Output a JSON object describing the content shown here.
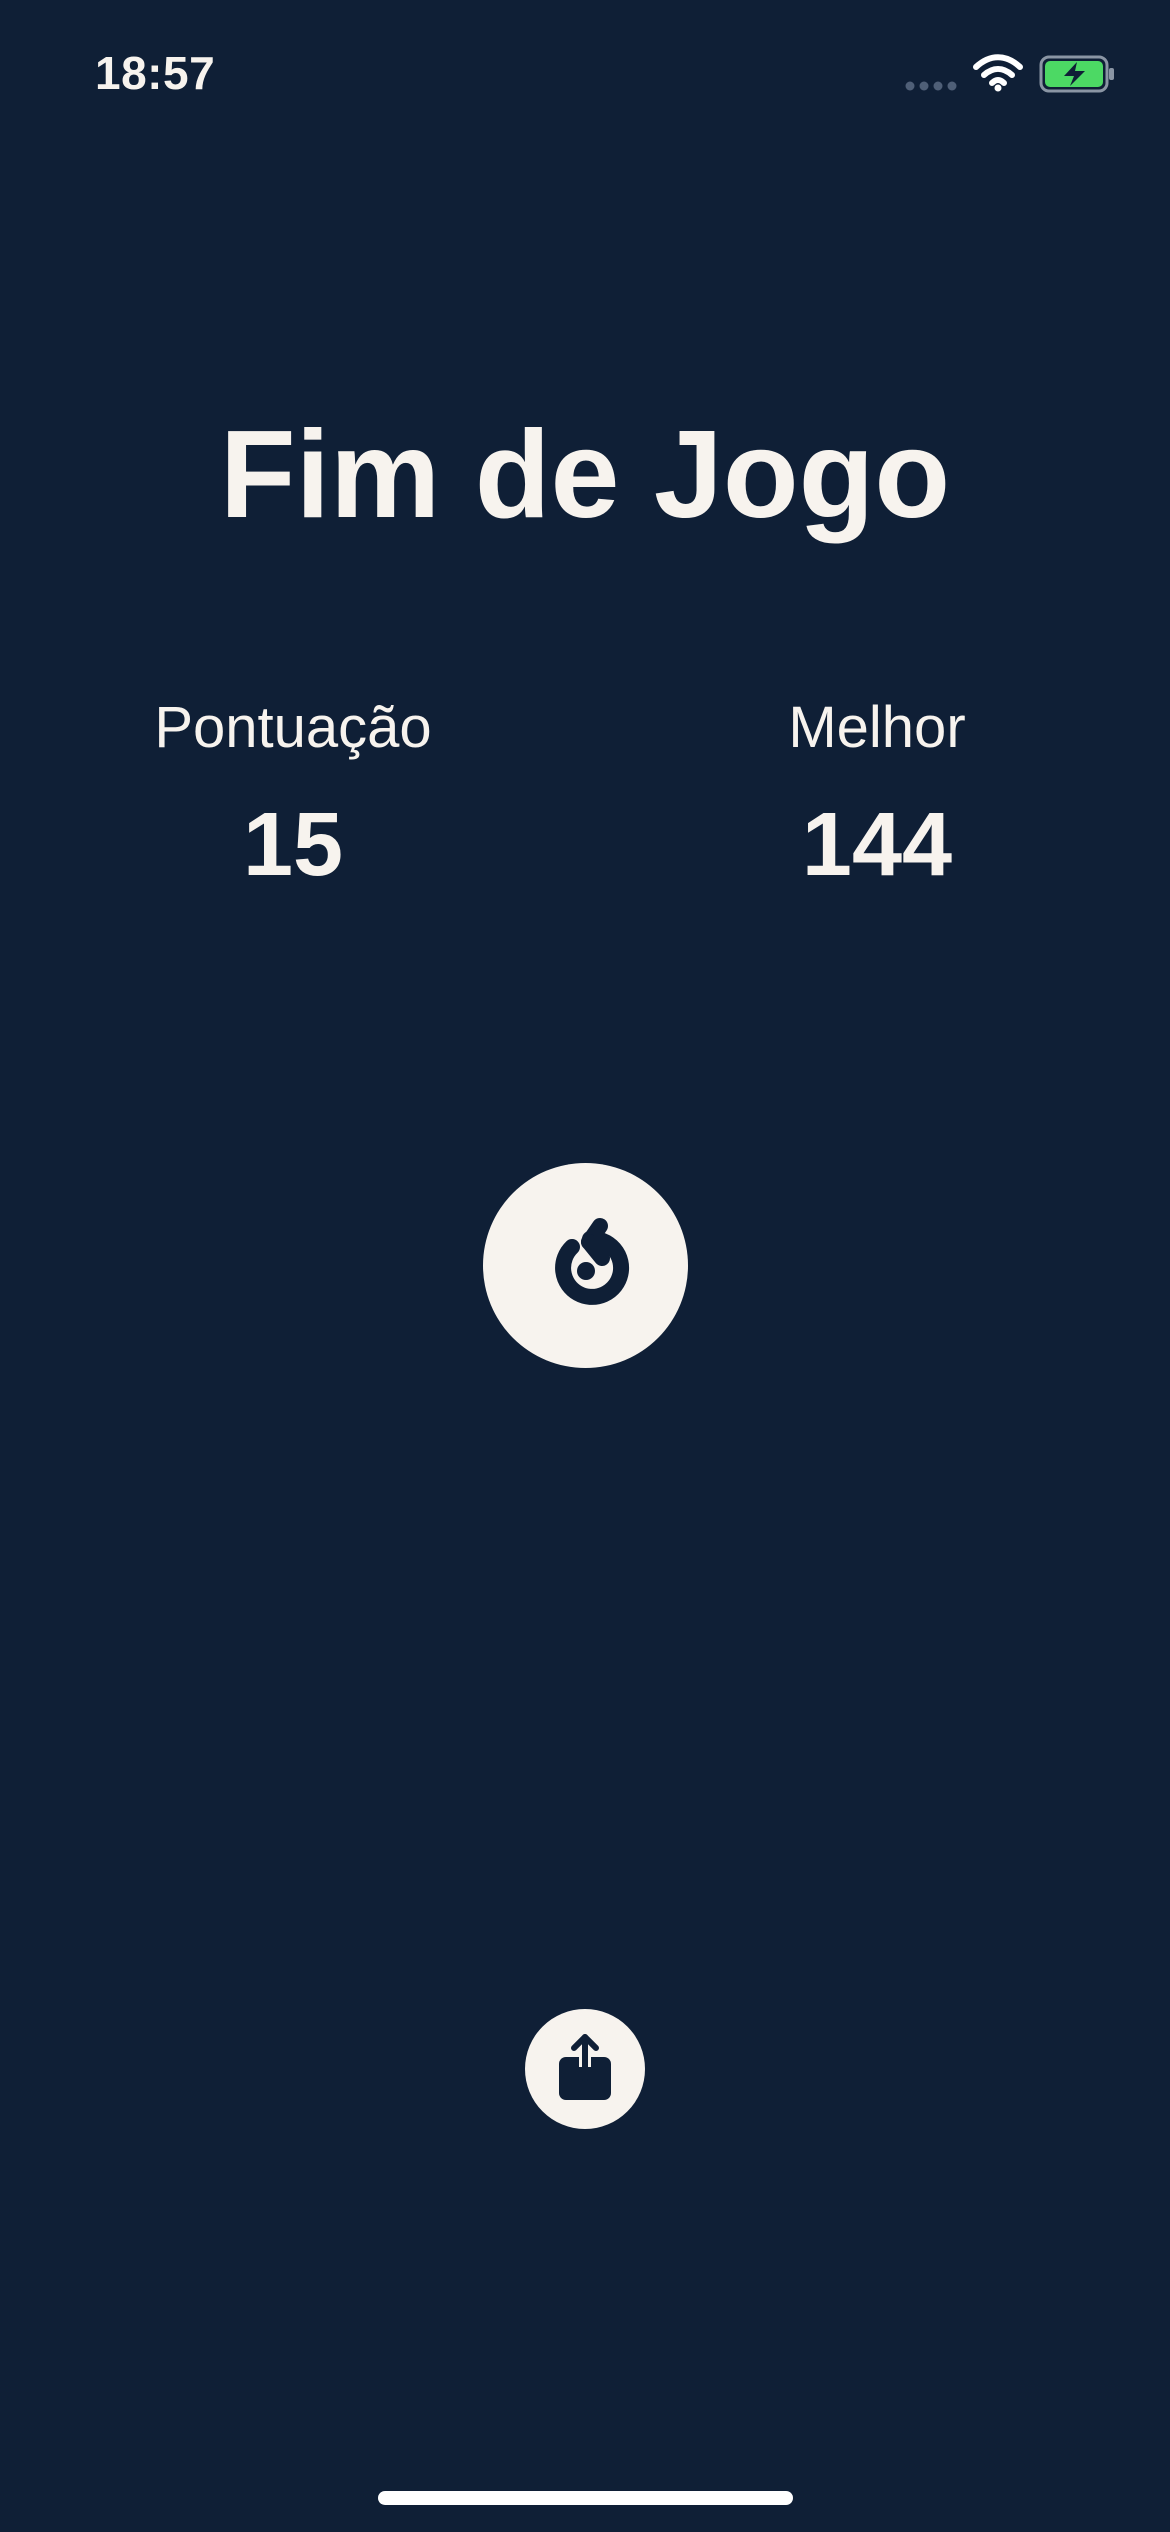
{
  "status_bar": {
    "time": "18:57",
    "icons": [
      "cellular-signal-icon",
      "wifi-icon",
      "battery-charging-icon"
    ],
    "battery_color": "#4cd964"
  },
  "screen": {
    "title": "Fim de Jogo",
    "score": {
      "label": "Pontuação",
      "value": "15"
    },
    "best": {
      "label": "Melhor",
      "value": "144"
    }
  },
  "actions": {
    "restart_icon": "restart-icon",
    "share_icon": "share-icon"
  },
  "colors": {
    "background": "#0f1f36",
    "foreground": "#f7f3ee"
  }
}
